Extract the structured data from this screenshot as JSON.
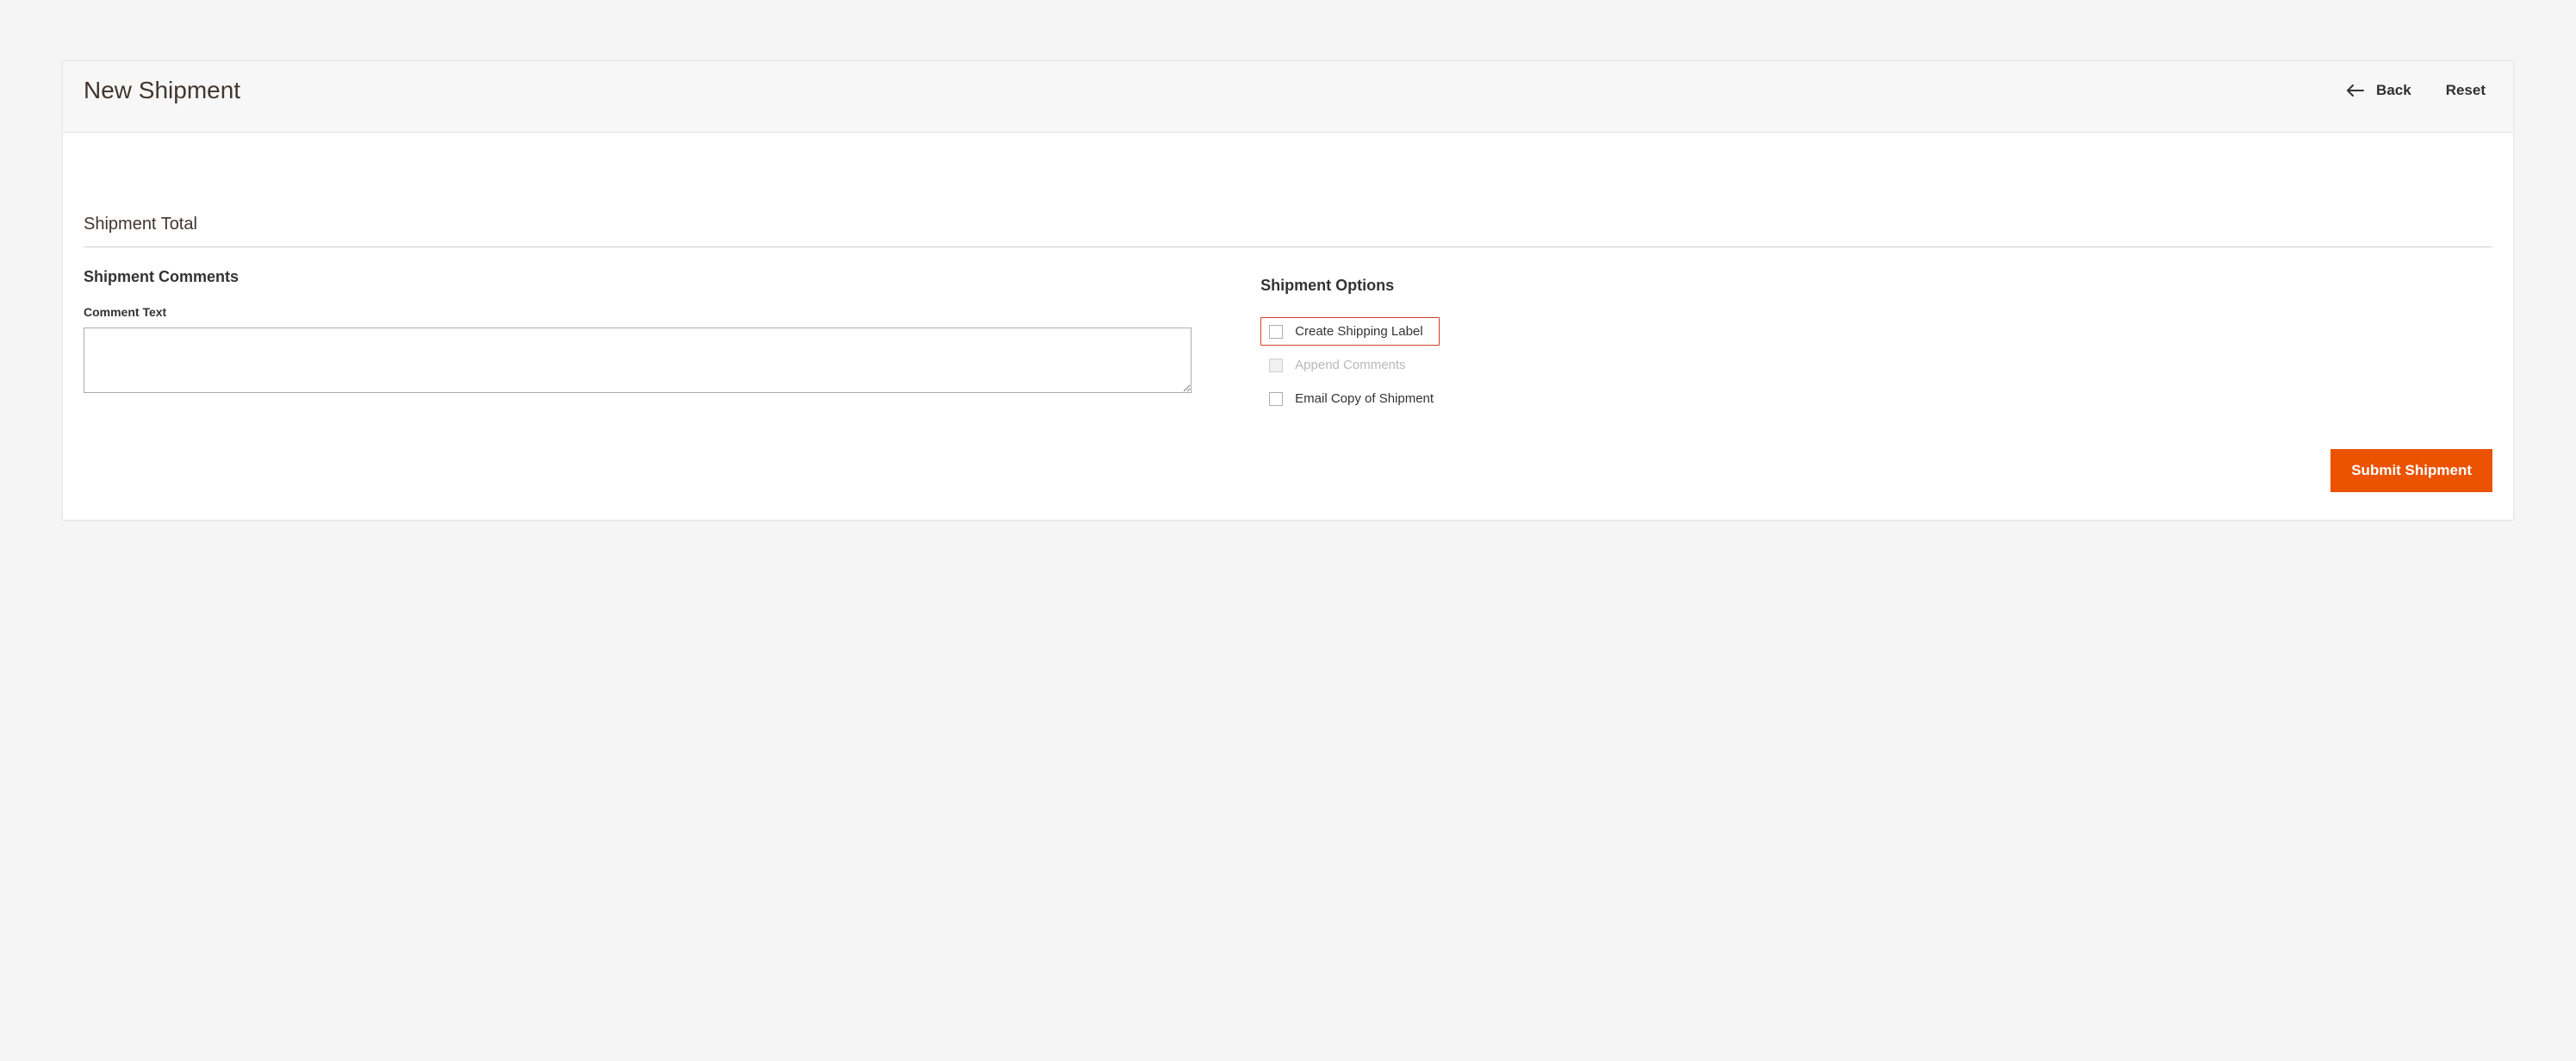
{
  "header": {
    "title": "New Shipment",
    "back_label": "Back",
    "reset_label": "Reset"
  },
  "section": {
    "title": "Shipment Total"
  },
  "comments": {
    "heading": "Shipment Comments",
    "field_label": "Comment Text",
    "value": ""
  },
  "options": {
    "heading": "Shipment Options",
    "items": [
      {
        "key": "create_label",
        "label": "Create Shipping Label",
        "checked": false,
        "disabled": false,
        "highlight": true
      },
      {
        "key": "append_comments",
        "label": "Append Comments",
        "checked": false,
        "disabled": true,
        "highlight": false
      },
      {
        "key": "email_copy",
        "label": "Email Copy of Shipment",
        "checked": false,
        "disabled": false,
        "highlight": false
      }
    ]
  },
  "actions": {
    "submit_label": "Submit Shipment"
  }
}
